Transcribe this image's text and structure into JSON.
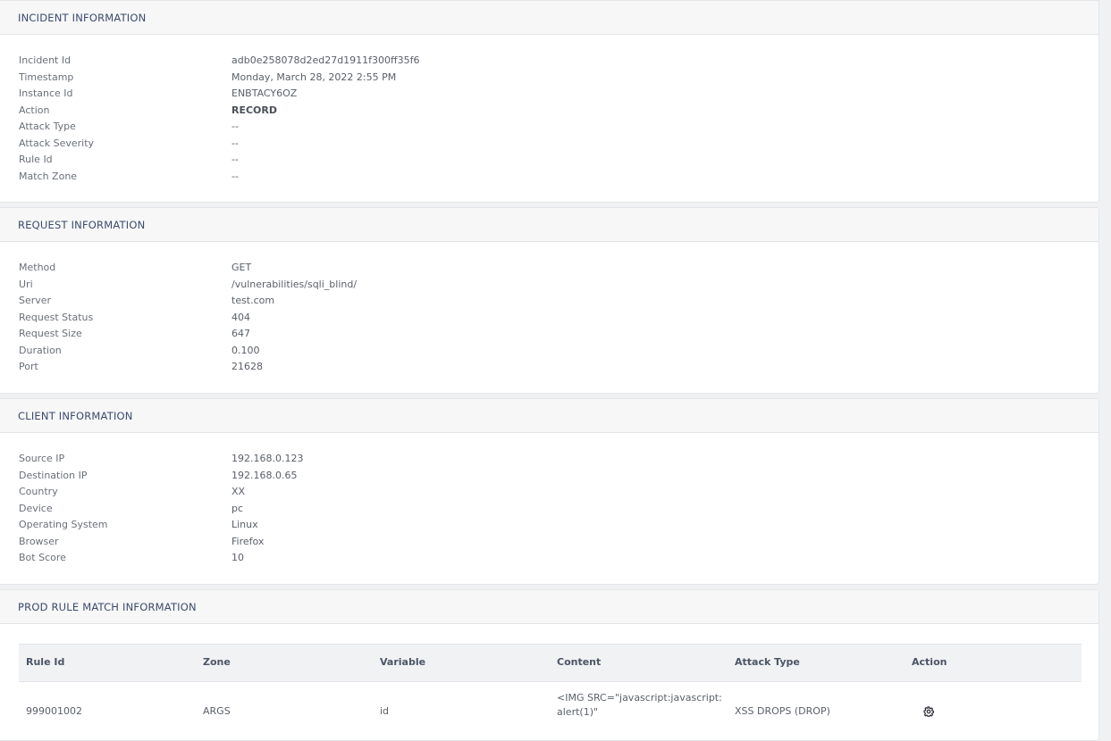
{
  "incident": {
    "title": "INCIDENT INFORMATION",
    "rows": [
      {
        "label": "Incident Id",
        "value": "adb0e258078d2ed27d1911f300ff35f6"
      },
      {
        "label": "Timestamp",
        "value": "Monday, March 28, 2022 2:55 PM"
      },
      {
        "label": "Instance Id",
        "value": "ENBTACY6OZ"
      },
      {
        "label": "Action",
        "value": "RECORD"
      },
      {
        "label": "Attack Type",
        "value": "--"
      },
      {
        "label": "Attack Severity",
        "value": "--"
      },
      {
        "label": "Rule Id",
        "value": "--"
      },
      {
        "label": "Match Zone",
        "value": "--"
      }
    ]
  },
  "request": {
    "title": "REQUEST INFORMATION",
    "rows": [
      {
        "label": "Method",
        "value": "GET"
      },
      {
        "label": "Uri",
        "value": "/vulnerabilities/sqli_blind/"
      },
      {
        "label": "Server",
        "value": "test.com"
      },
      {
        "label": "Request Status",
        "value": "404"
      },
      {
        "label": "Request Size",
        "value": "647"
      },
      {
        "label": "Duration",
        "value": "0.100"
      },
      {
        "label": "Port",
        "value": "21628"
      }
    ]
  },
  "client": {
    "title": "CLIENT INFORMATION",
    "rows": [
      {
        "label": "Source IP",
        "value": "192.168.0.123"
      },
      {
        "label": "Destination IP",
        "value": "192.168.0.65"
      },
      {
        "label": "Country",
        "value": "XX"
      },
      {
        "label": "Device",
        "value": "pc"
      },
      {
        "label": "Operating System",
        "value": "Linux"
      },
      {
        "label": "Browser",
        "value": "Firefox"
      },
      {
        "label": "Bot Score",
        "value": "10"
      }
    ]
  },
  "rule_match": {
    "title": "PROD RULE MATCH INFORMATION",
    "columns": [
      "Rule Id",
      "Zone",
      "Variable",
      "Content",
      "Attack Type",
      "Action"
    ],
    "rows": [
      {
        "rule_id": "999001002",
        "zone": "ARGS",
        "variable": "id",
        "content": "<IMG SRC=\"javascript:javascript:alert(1)\"",
        "attack_type": "XSS DROPS (DROP)",
        "action_icon": "gear-icon"
      }
    ]
  }
}
